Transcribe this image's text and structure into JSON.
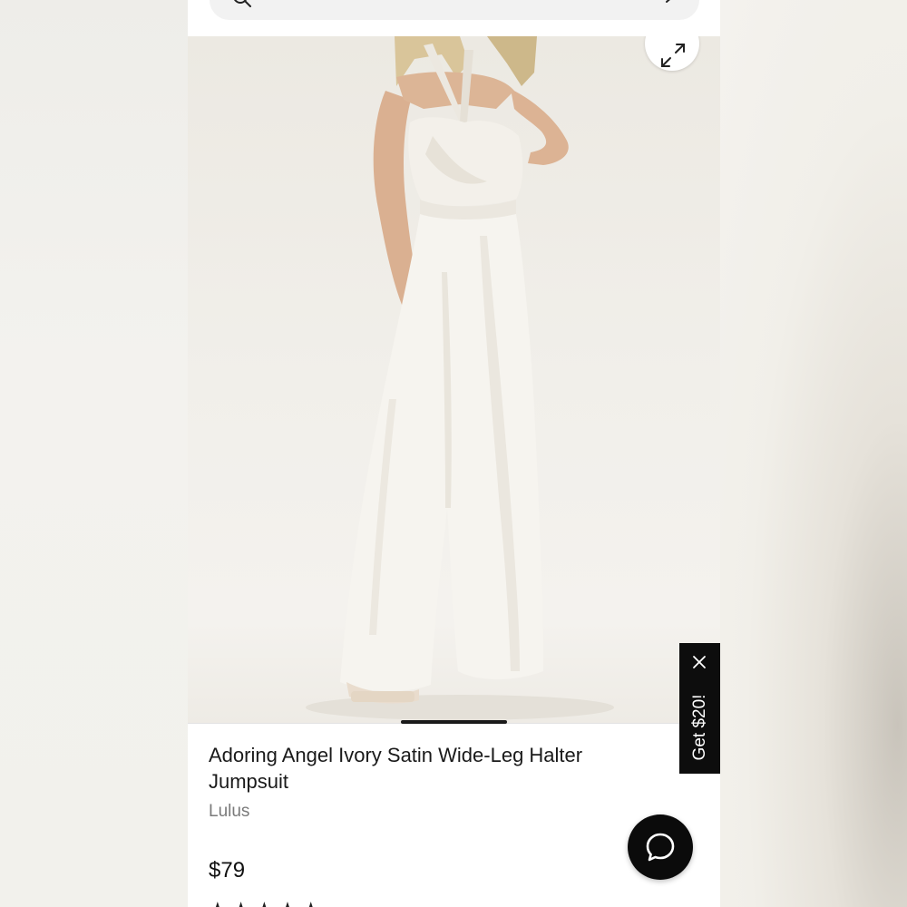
{
  "product": {
    "title": "Adoring Angel Ivory Satin Wide-Leg Halter Jumpsuit",
    "brand": "Lulus",
    "price": "$79",
    "rating_stars": "★★★★★"
  },
  "promo": {
    "label": "Get $20!"
  },
  "icons": {
    "search": "search-icon",
    "chevron": "chevron-right-icon",
    "expand": "expand-icon",
    "close": "close-icon",
    "chat": "chat-bubble-icon"
  },
  "colors": {
    "accent": "#0b0b0b",
    "text": "#1a1a1a",
    "brand_text": "#7a7a7a"
  }
}
